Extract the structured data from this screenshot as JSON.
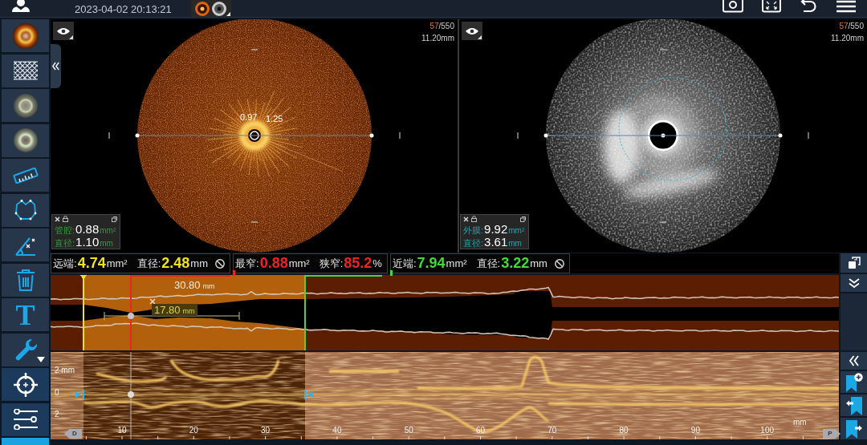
{
  "header": {
    "datetime": "2023-04-02 20:13:21"
  },
  "toolbar": {
    "text_tool": "T"
  },
  "views": [
    {
      "kind": "oct",
      "frame_current": "57",
      "frame_total": "/550",
      "depth": "11.20mm",
      "labels": [
        "0.97",
        "1.25"
      ],
      "measure": {
        "color": "#2f9c3a",
        "rows": [
          {
            "label": "管腔:",
            "value": "0.88",
            "unit": "mm²"
          },
          {
            "label": "直径:",
            "value": "1.10",
            "unit": "mm"
          }
        ]
      }
    },
    {
      "kind": "ivus",
      "frame_current": "57",
      "frame_total": "/550",
      "depth": "11.20mm",
      "measure": {
        "color": "#2b9ea6",
        "rows": [
          {
            "label": "外膜:",
            "value": "9.92",
            "unit": "mm²"
          },
          {
            "label": "直径:",
            "value": "3.61",
            "unit": "mm"
          }
        ]
      }
    }
  ],
  "summary": [
    {
      "color": "#f2e21c",
      "clearable": true,
      "items": [
        {
          "label": "远端:",
          "value": "4.74",
          "unit": "mm²"
        },
        {
          "label": "直径:",
          "value": "2.48",
          "unit": "mm"
        }
      ]
    },
    {
      "color": "#ec2424",
      "clearable": false,
      "items": [
        {
          "label": "最窄:",
          "value": "0.88",
          "unit": "mm²"
        },
        {
          "label": "狭窄:",
          "value": "85.2",
          "unit": "%"
        }
      ]
    },
    {
      "color": "#44d83c",
      "clearable": true,
      "items": [
        {
          "label": "近端:",
          "value": "7.94",
          "unit": "mm²"
        },
        {
          "label": "直径:",
          "value": "3.22",
          "unit": "mm"
        }
      ]
    }
  ],
  "profile": {
    "length": {
      "value": "30.80",
      "unit": "mm"
    },
    "measurement": {
      "value": "17.80",
      "unit": "mm"
    }
  },
  "scan": {
    "y_labels": [
      "2 mm",
      "0",
      "2"
    ],
    "x_labels": [
      "10",
      "20",
      "30",
      "40",
      "50",
      "60",
      "70",
      "80",
      "90",
      "100"
    ],
    "x_unit": "mm",
    "distal_tag": "D",
    "proximal_tag": "P"
  }
}
